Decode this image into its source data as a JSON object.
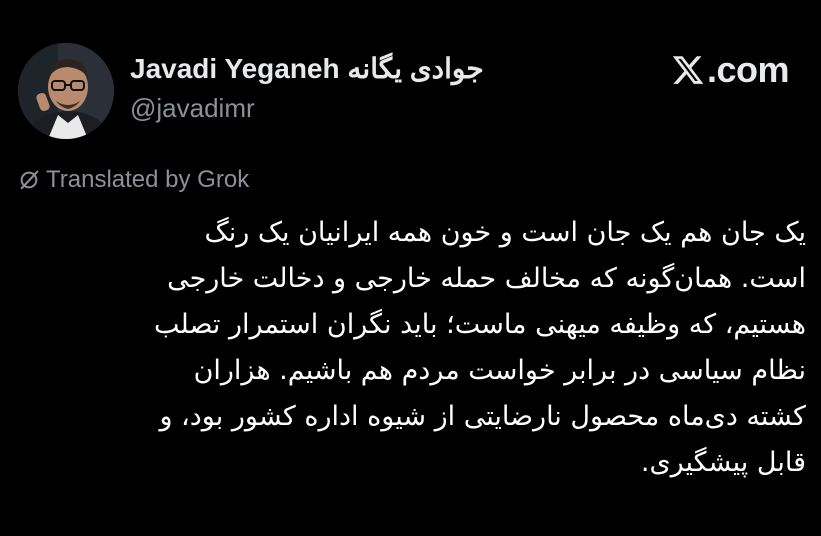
{
  "profile": {
    "display_name": "Javadi Yeganeh جوادی یگانه",
    "handle": "@javadimr",
    "avatar_icon": "user-photo"
  },
  "brand": {
    "text": ".com",
    "logo_icon": "x-logo-icon"
  },
  "translation": {
    "label": "Translated by Grok",
    "icon": "grok-icon"
  },
  "tweet": {
    "lines": [
      "یک جان هم یک جان است و خون همه ایرانیان  یک رنگ",
      "است. همان‌گونه که مخالف حمله خارجی و دخالت خارجی",
      "هستیم، که وظیفه میهنی ماست؛ باید نگران استمرار تصلب",
      "نظام سیاسی در برابر خواست مردم هم باشیم. هزاران",
      "کشته دی‌ماه محصول نارضایتی از شیوه اداره کشور بود، و",
      "قابل پیشگیری."
    ]
  },
  "colors": {
    "background": "#000000",
    "text_primary": "#e7e9ea",
    "text_secondary": "#8b9198"
  }
}
